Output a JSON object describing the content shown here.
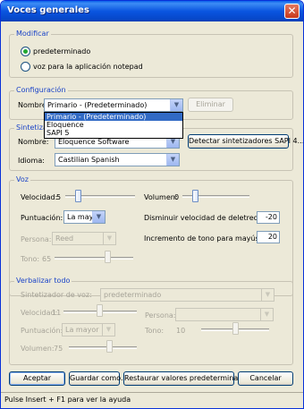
{
  "window": {
    "title": "Voces generales"
  },
  "modificar": {
    "label": "Modificar",
    "option_default": "predeterminado",
    "option_app": "voz para la aplicación notepad",
    "selected": "predeterminado"
  },
  "configuracion": {
    "label": "Configuración",
    "name_label": "Nombre:",
    "name_value": "Primario - (Predeterminado)",
    "dropdown_options": [
      "Primario - (Predeterminado)",
      "Eloquence",
      "SAPI 5"
    ],
    "delete_button": "Eliminar"
  },
  "sintetizador": {
    "label": "Sintetizador",
    "name_label": "Nombre:",
    "name_value": "Eloquence Software",
    "detect_button": "Detectar sintetizadores SAPI 4...",
    "language_label": "Idioma:",
    "language_value": "Castilian Spanish"
  },
  "voz": {
    "label": "Voz",
    "velocidad_label": "Velocidad:",
    "velocidad_value": "5",
    "volumen_label": "Volumen:",
    "volumen_value": "0",
    "puntuacion_label": "Puntuación:",
    "puntuacion_value": "La mayor",
    "deletreo_label": "Disminuir velocidad de deletreo:",
    "deletreo_value": "-20",
    "persona_label": "Persona:",
    "persona_value": "Reed",
    "mayusculas_label": "Incremento de tono para mayúsculas:",
    "mayusculas_value": "20",
    "tono_label": "Tono:",
    "tono_value": "65"
  },
  "verbalizar": {
    "label": "Verbalizar todo",
    "sintetizador_label": "Sintetizador de voz:",
    "sintetizador_value": "predeterminado",
    "velocidad_label": "Velocidad:",
    "velocidad_value": "11",
    "persona_label": "Persona:",
    "puntuacion_label": "Puntuación:",
    "puntuacion_value": "La mayor",
    "tono_label": "Tono:",
    "tono_value": "10",
    "volumen_label": "Volumen:",
    "volumen_value": "75"
  },
  "buttons": {
    "accept": "Aceptar",
    "save_as": "Guardar como...",
    "restore": "Restaurar valores predeterminados",
    "cancel": "Cancelar"
  },
  "status": {
    "text": "Pulse Insert + F1 para ver la ayuda"
  },
  "colors": {
    "title_bar": "#0a55e0",
    "group_label": "#1b44c8",
    "selection": "#316ac5"
  }
}
